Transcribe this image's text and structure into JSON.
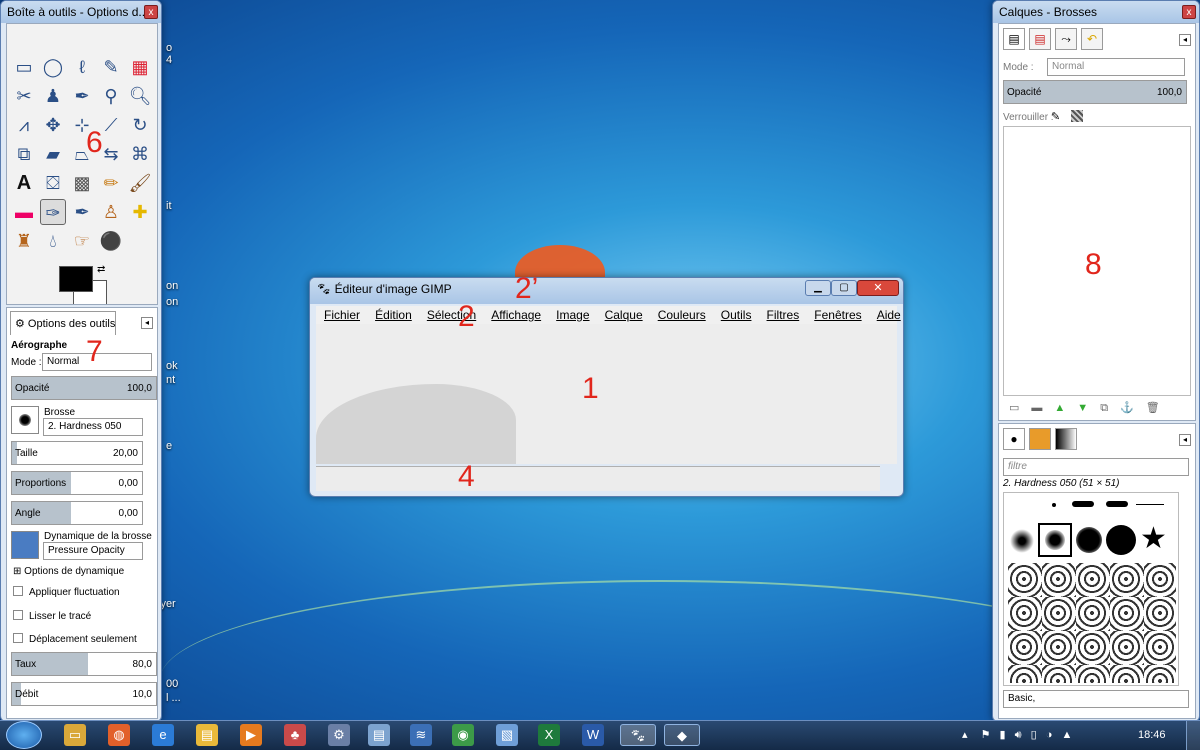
{
  "toolbox": {
    "title": "Boîte à outils - Options d...",
    "close": "x",
    "tabs": {
      "options_label": "Options des outils"
    },
    "tool_name": "Aérographe",
    "mode_label": "Mode :",
    "mode_value": "Normal",
    "opacity_label": "Opacité",
    "opacity_value": "100,0",
    "opacity_fraction": 1.0,
    "brush_label": "Brosse",
    "brush_value": "2. Hardness 050",
    "size_label": "Taille",
    "size_value": "20,00",
    "proportions_label": "Proportions",
    "proportions_value": "0,00",
    "angle_label": "Angle",
    "angle_value": "0,00",
    "dynamics_label": "Dynamique de la brosse",
    "dynamics_value": "Pressure Opacity",
    "dynamics_options": "Options de dynamique",
    "check_fluctuation": "Appliquer fluctuation",
    "check_smooth": "Lisser le tracé",
    "check_move": "Déplacement seulement",
    "rate_label": "Taux",
    "rate_value": "80,0",
    "flow_label": "Débit",
    "flow_value": "10,0"
  },
  "image_window": {
    "title": "Éditeur d'image GIMP",
    "menu": [
      "Fichier",
      "Édition",
      "Sélection",
      "Affichage",
      "Image",
      "Calque",
      "Couleurs",
      "Outils",
      "Filtres",
      "Fenêtres",
      "Aide"
    ]
  },
  "layers": {
    "title": "Calques - Brosses",
    "close": "x",
    "mode_label": "Mode :",
    "mode_value": "Normal",
    "opacity_label": "Opacité",
    "opacity_value": "100,0",
    "lock_label": "Verrouiller :",
    "filter_placeholder": "filtre",
    "brush_name": "2. Hardness 050 (51 × 51)",
    "preset_value": "Basic,"
  },
  "annotations": {
    "n1": "1",
    "n2": "2",
    "n2p": "2’",
    "n4": "4",
    "n6": "6",
    "n7": "7",
    "n8": "8"
  },
  "desktop_fragments": [
    "o",
    "4",
    "it",
    "on",
    "on",
    "ok",
    "nt",
    "e",
    "lyer",
    "00",
    "l ..."
  ],
  "taskbar": {
    "time": "18:46"
  },
  "colors": {
    "accent_red": "#e1261c",
    "taskbar": "#1c3b63"
  }
}
